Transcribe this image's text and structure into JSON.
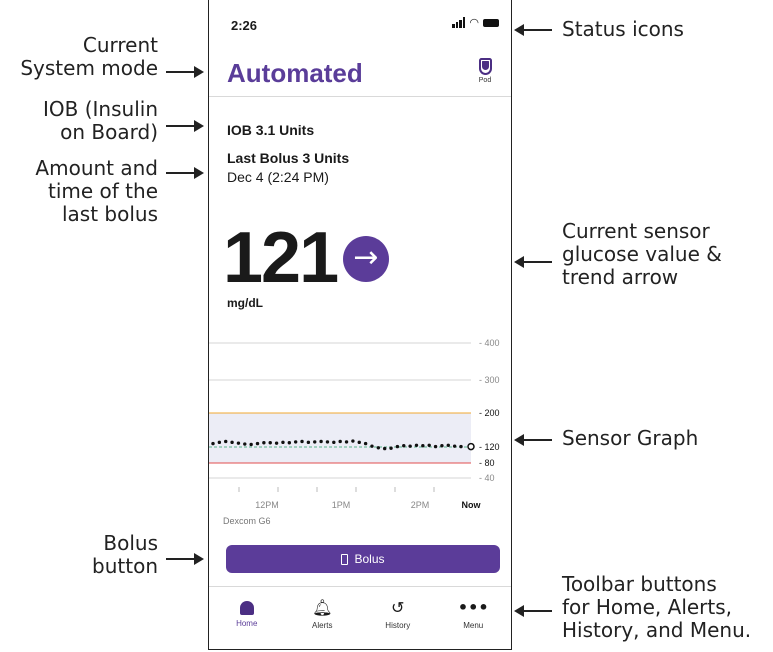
{
  "annotations": {
    "status_icons": "Status icons",
    "mode_line1": "Current",
    "mode_line2": "System mode",
    "iob_line1": "IOB (Insulin",
    "iob_line2": "on Board)",
    "bolus_info_line1": "Amount and",
    "bolus_info_line2": "time of the",
    "bolus_info_line3": "last bolus",
    "glucose_line1": "Current sensor",
    "glucose_line2": "glucose value &",
    "glucose_line3": "trend arrow",
    "graph": "Sensor Graph",
    "bolus_btn_line1": "Bolus",
    "bolus_btn_line2": "button",
    "toolbar_line1": "Toolbar buttons",
    "toolbar_line2": "for Home, Alerts,",
    "toolbar_line3": "History, and Menu."
  },
  "phone": {
    "status": {
      "time": "2:26"
    },
    "header": {
      "title": "Automated",
      "pod_label": "Pod"
    },
    "iob": "IOB 3.1 Units",
    "last_bolus": {
      "amount": "Last Bolus 3 Units",
      "time": "Dec 4 (2:24 PM)"
    },
    "glucose": {
      "value": "121",
      "unit": "mg/dL",
      "trend_glyph": "→"
    },
    "chart_data": {
      "type": "scatter",
      "title": "",
      "xlabel": "",
      "ylabel": "",
      "x_ticks": [
        "12PM",
        "1PM",
        "2PM",
        "Now"
      ],
      "y_ticks": [
        "400",
        "300",
        "200",
        "120",
        "80",
        "40"
      ],
      "target_range": [
        80,
        200
      ],
      "target_line": 120,
      "colors": {
        "high": "#f0a830",
        "low": "#e24d4d",
        "target": "#59b38a",
        "band": "#ecedf6",
        "accent": "#5b3c99"
      },
      "series": [
        {
          "values": [
            128,
            131,
            133,
            131,
            129,
            127,
            126,
            128,
            130,
            130,
            129,
            131,
            130,
            132,
            133,
            131,
            132,
            133,
            132,
            131,
            133,
            132,
            134,
            131,
            128,
            122,
            118,
            116,
            117,
            121,
            123,
            122,
            124,
            123,
            124,
            121,
            123,
            124,
            122,
            121
          ]
        }
      ],
      "current_value": 121
    },
    "sensor_name": "Dexcom G6",
    "bolus_button": "Bolus",
    "toolbar": [
      {
        "label": "Home"
      },
      {
        "label": "Alerts"
      },
      {
        "label": "History"
      },
      {
        "label": "Menu"
      }
    ]
  }
}
